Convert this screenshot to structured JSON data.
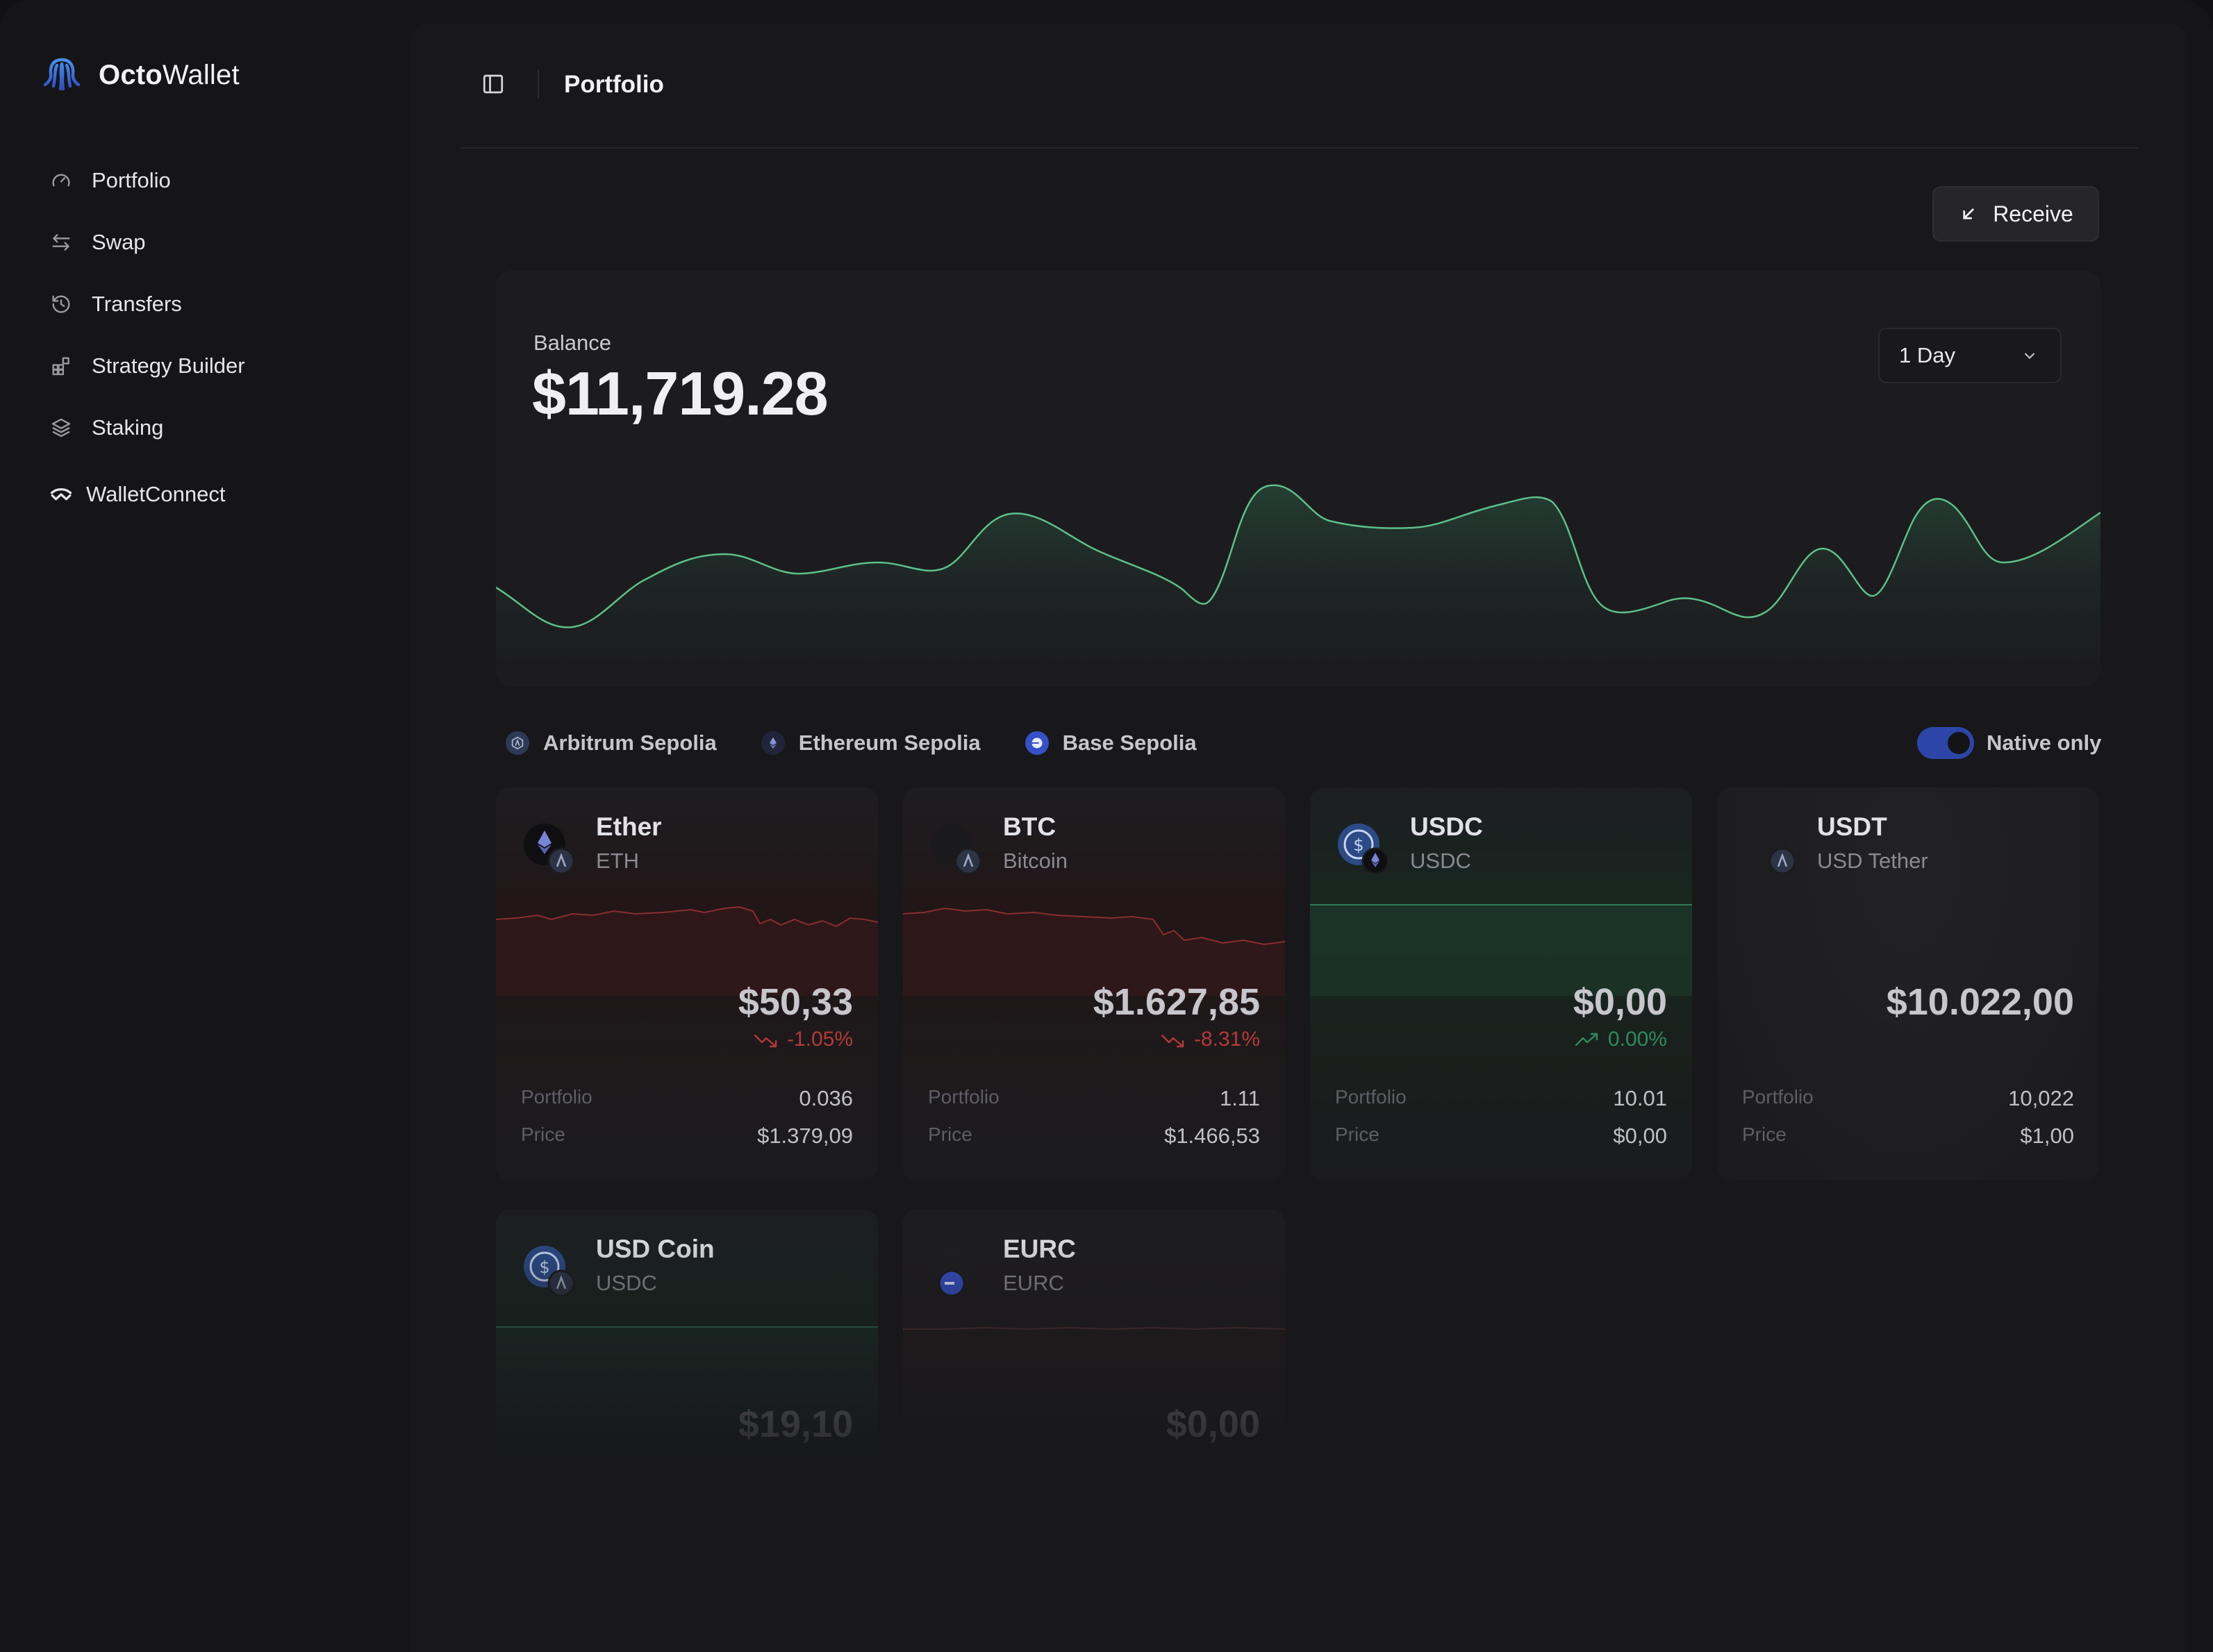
{
  "app": {
    "name_bold": "Octo",
    "name_rest": "Wallet"
  },
  "sidebar": {
    "items": [
      {
        "label": "Portfolio",
        "icon": "gauge-icon"
      },
      {
        "label": "Swap",
        "icon": "swap-arrows-icon"
      },
      {
        "label": "Transfers",
        "icon": "history-icon"
      },
      {
        "label": "Strategy Builder",
        "icon": "blocks-icon"
      },
      {
        "label": "Staking",
        "icon": "layers-icon"
      }
    ],
    "walletconnect": {
      "label": "WalletConnect",
      "icon": "walletconnect-icon"
    }
  },
  "header": {
    "title": "Portfolio"
  },
  "receive": {
    "label": "Receive"
  },
  "balance": {
    "label": "Balance",
    "value": "$11,719.28",
    "range": "1 Day",
    "accent": "#5cc08a"
  },
  "networks": [
    {
      "label": "Arbitrum Sepolia",
      "color": "#2d3a55"
    },
    {
      "label": "Ethereum Sepolia",
      "color": "#22243a"
    },
    {
      "label": "Base Sepolia",
      "color": "#3550c8"
    }
  ],
  "native_only": {
    "label": "Native only",
    "on": true
  },
  "assets": [
    {
      "name": "Ether",
      "symbol": "ETH",
      "price": "$50,33",
      "change": "-1.05%",
      "trend": "down",
      "portfolio_label": "Portfolio",
      "portfolio": "0.036",
      "price_label": "Price",
      "unit_price": "$1.379,09"
    },
    {
      "name": "BTC",
      "symbol": "Bitcoin",
      "price": "$1.627,85",
      "change": "-8.31%",
      "trend": "down",
      "portfolio_label": "Portfolio",
      "portfolio": "1.11",
      "price_label": "Price",
      "unit_price": "$1.466,53"
    },
    {
      "name": "USDC",
      "symbol": "USDC",
      "price": "$0,00",
      "change": "0.00%",
      "trend": "up",
      "portfolio_label": "Portfolio",
      "portfolio": "10.01",
      "price_label": "Price",
      "unit_price": "$0,00"
    },
    {
      "name": "USDT",
      "symbol": "USD Tether",
      "price": "$10.022,00",
      "change": "",
      "trend": "none",
      "portfolio_label": "Portfolio",
      "portfolio": "10,022",
      "price_label": "Price",
      "unit_price": "$1,00"
    },
    {
      "name": "USD Coin",
      "symbol": "USDC",
      "price": "$19,10"
    },
    {
      "name": "EURC",
      "symbol": "EURC",
      "price": "$0,00"
    }
  ]
}
